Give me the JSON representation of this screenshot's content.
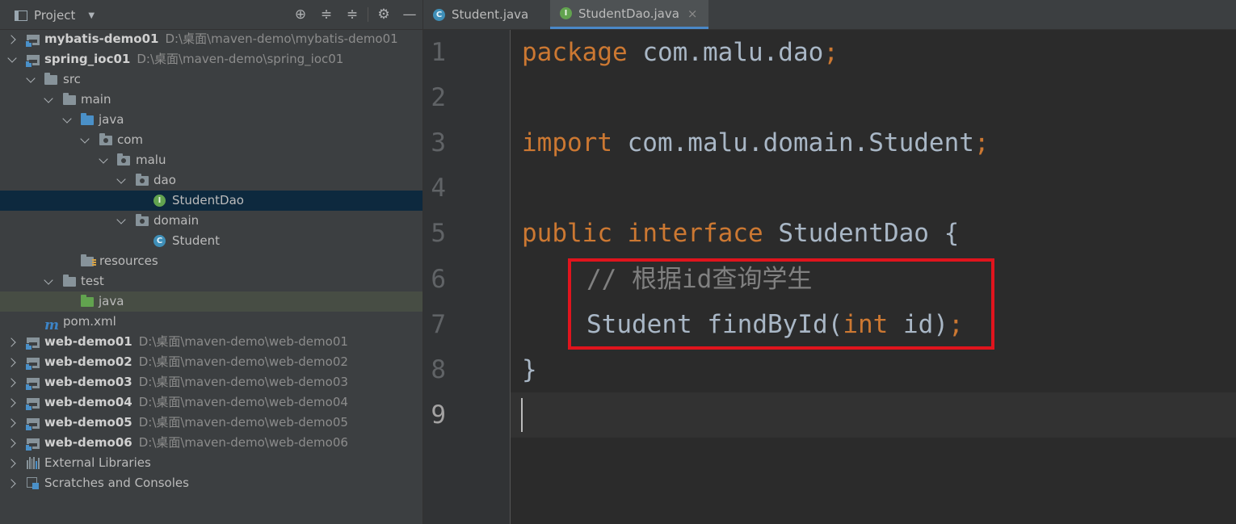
{
  "panel": {
    "title": "Project"
  },
  "tree": [
    {
      "name": "mybatis-demo01",
      "path": "D:\\桌面\\maven-demo\\mybatis-demo01",
      "type": "module",
      "bold": true
    },
    {
      "name": "spring_ioc01",
      "path": "D:\\桌面\\maven-demo\\spring_ioc01",
      "type": "module",
      "bold": true
    },
    {
      "name": "src",
      "type": "folder"
    },
    {
      "name": "main",
      "type": "folder"
    },
    {
      "name": "java",
      "type": "folder-blue"
    },
    {
      "name": "com",
      "type": "package"
    },
    {
      "name": "malu",
      "type": "package"
    },
    {
      "name": "dao",
      "type": "package"
    },
    {
      "name": "StudentDao",
      "type": "interface"
    },
    {
      "name": "domain",
      "type": "package"
    },
    {
      "name": "Student",
      "type": "class"
    },
    {
      "name": "resources",
      "type": "resources"
    },
    {
      "name": "test",
      "type": "folder"
    },
    {
      "name": "java",
      "type": "folder-green"
    },
    {
      "name": "pom.xml",
      "type": "maven"
    },
    {
      "name": "web-demo01",
      "path": "D:\\桌面\\maven-demo\\web-demo01",
      "type": "module",
      "bold": true
    },
    {
      "name": "web-demo02",
      "path": "D:\\桌面\\maven-demo\\web-demo02",
      "type": "module",
      "bold": true
    },
    {
      "name": "web-demo03",
      "path": "D:\\桌面\\maven-demo\\web-demo03",
      "type": "module",
      "bold": true
    },
    {
      "name": "web-demo04",
      "path": "D:\\桌面\\maven-demo\\web-demo04",
      "type": "module",
      "bold": true
    },
    {
      "name": "web-demo05",
      "path": "D:\\桌面\\maven-demo\\web-demo05",
      "type": "module",
      "bold": true
    },
    {
      "name": "web-demo06",
      "path": "D:\\桌面\\maven-demo\\web-demo06",
      "type": "module",
      "bold": true
    },
    {
      "name": "External Libraries",
      "type": "libraries"
    },
    {
      "name": "Scratches and Consoles",
      "type": "scratches"
    }
  ],
  "tabs": [
    {
      "label": "Student.java",
      "icon": "class-icon",
      "active": false
    },
    {
      "label": "StudentDao.java",
      "icon": "interface-icon",
      "active": true
    }
  ],
  "icons": {
    "class_letter": "C",
    "interface_letter": "I",
    "maven_letter": "m",
    "close_glyph": "×"
  },
  "editor": {
    "line_numbers": [
      "1",
      "2",
      "3",
      "4",
      "5",
      "6",
      "7",
      "8",
      "9"
    ],
    "current_line": "9",
    "lines": {
      "l1": {
        "kw": "package",
        "rest": " com.malu.dao",
        "semi": ";"
      },
      "l3": {
        "kw": "import",
        "rest": " com.malu.domain.Student",
        "semi": ";"
      },
      "l5": {
        "kw1": "public",
        "kw2": "interface",
        "name": "StudentDao",
        "brace": "{"
      },
      "l6": {
        "comment": "// 根据id查询学生"
      },
      "l7": {
        "type": "Student",
        "method": "findById",
        "open": "(",
        "ptype": "int",
        "pname": " id",
        "close": ")",
        "semi": ";"
      },
      "l8": {
        "brace": "}"
      }
    }
  },
  "colors": {
    "keyword": "#cc7832",
    "comment": "#808080",
    "highlight_box": "#e0141d",
    "selection": "#0d293e"
  }
}
